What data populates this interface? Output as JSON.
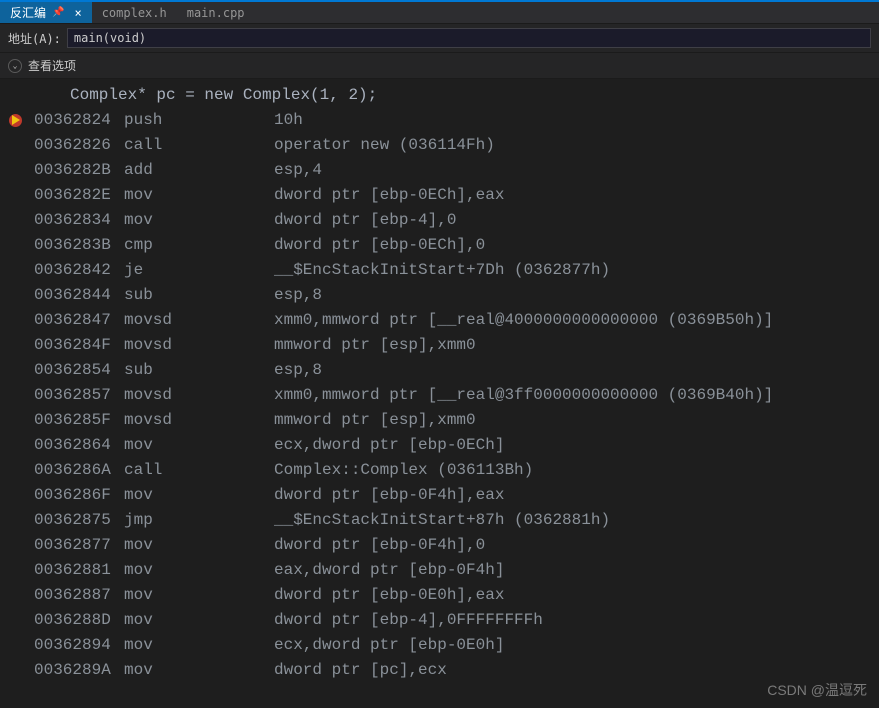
{
  "tabs": [
    {
      "label": "反汇编",
      "pinned": true,
      "closeable": true,
      "active": true
    },
    {
      "label": "complex.h",
      "pinned": false,
      "closeable": false,
      "active": false
    },
    {
      "label": "main.cpp",
      "pinned": false,
      "closeable": false,
      "active": false
    }
  ],
  "address_bar": {
    "label": "地址(A):",
    "value": "main(void)"
  },
  "view_options": {
    "label": "查看选项"
  },
  "source_line": "    Complex* pc = new Complex(1, 2);",
  "disasm": [
    {
      "bp": true,
      "addr": "00362824",
      "mnem": "push",
      "ops": "10h"
    },
    {
      "bp": false,
      "addr": "00362826",
      "mnem": "call",
      "ops": "operator new (036114Fh)"
    },
    {
      "bp": false,
      "addr": "0036282B",
      "mnem": "add",
      "ops": "esp,4"
    },
    {
      "bp": false,
      "addr": "0036282E",
      "mnem": "mov",
      "ops": "dword ptr [ebp-0ECh],eax"
    },
    {
      "bp": false,
      "addr": "00362834",
      "mnem": "mov",
      "ops": "dword ptr [ebp-4],0"
    },
    {
      "bp": false,
      "addr": "0036283B",
      "mnem": "cmp",
      "ops": "dword ptr [ebp-0ECh],0"
    },
    {
      "bp": false,
      "addr": "00362842",
      "mnem": "je",
      "ops": "__$EncStackInitStart+7Dh (0362877h)"
    },
    {
      "bp": false,
      "addr": "00362844",
      "mnem": "sub",
      "ops": "esp,8"
    },
    {
      "bp": false,
      "addr": "00362847",
      "mnem": "movsd",
      "ops": "xmm0,mmword ptr [__real@4000000000000000 (0369B50h)]"
    },
    {
      "bp": false,
      "addr": "0036284F",
      "mnem": "movsd",
      "ops": "mmword ptr [esp],xmm0"
    },
    {
      "bp": false,
      "addr": "00362854",
      "mnem": "sub",
      "ops": "esp,8"
    },
    {
      "bp": false,
      "addr": "00362857",
      "mnem": "movsd",
      "ops": "xmm0,mmword ptr [__real@3ff0000000000000 (0369B40h)]"
    },
    {
      "bp": false,
      "addr": "0036285F",
      "mnem": "movsd",
      "ops": "mmword ptr [esp],xmm0"
    },
    {
      "bp": false,
      "addr": "00362864",
      "mnem": "mov",
      "ops": "ecx,dword ptr [ebp-0ECh]"
    },
    {
      "bp": false,
      "addr": "0036286A",
      "mnem": "call",
      "ops": "Complex::Complex (036113Bh)"
    },
    {
      "bp": false,
      "addr": "0036286F",
      "mnem": "mov",
      "ops": "dword ptr [ebp-0F4h],eax"
    },
    {
      "bp": false,
      "addr": "00362875",
      "mnem": "jmp",
      "ops": "__$EncStackInitStart+87h (0362881h)"
    },
    {
      "bp": false,
      "addr": "00362877",
      "mnem": "mov",
      "ops": "dword ptr [ebp-0F4h],0"
    },
    {
      "bp": false,
      "addr": "00362881",
      "mnem": "mov",
      "ops": "eax,dword ptr [ebp-0F4h]"
    },
    {
      "bp": false,
      "addr": "00362887",
      "mnem": "mov",
      "ops": "dword ptr [ebp-0E0h],eax"
    },
    {
      "bp": false,
      "addr": "0036288D",
      "mnem": "mov",
      "ops": "dword ptr [ebp-4],0FFFFFFFFh"
    },
    {
      "bp": false,
      "addr": "00362894",
      "mnem": "mov",
      "ops": "ecx,dword ptr [ebp-0E0h]"
    },
    {
      "bp": false,
      "addr": "0036289A",
      "mnem": "mov",
      "ops": "dword ptr [pc],ecx"
    }
  ],
  "watermark": "CSDN @温逗死",
  "icons": {
    "pin": "📌",
    "close": "×",
    "chevron": "⌄"
  }
}
